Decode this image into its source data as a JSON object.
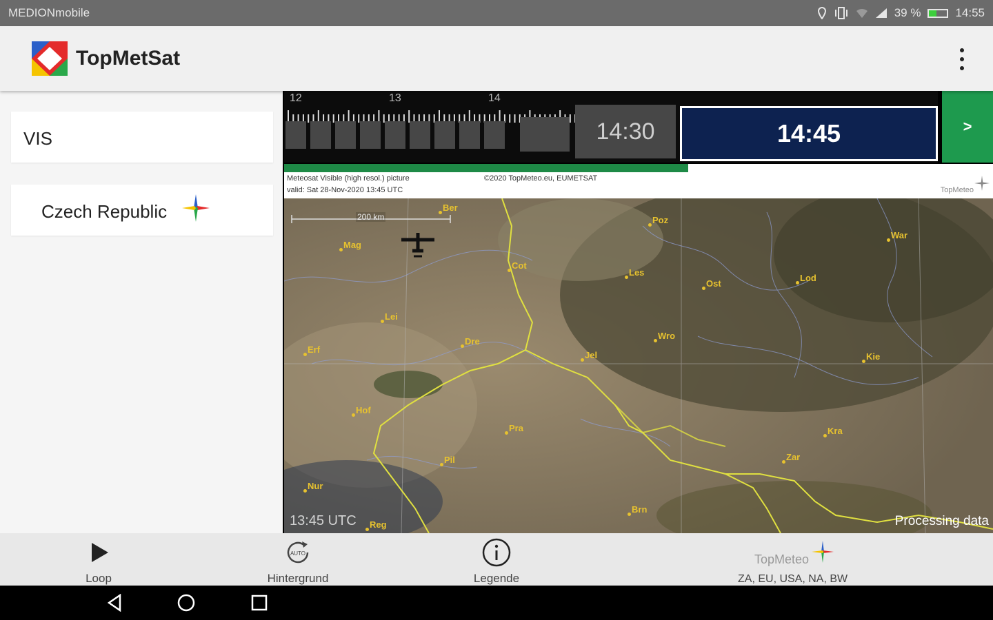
{
  "status_bar": {
    "carrier": "MEDIONmobile",
    "battery": "39 %",
    "battery_level": 0.39,
    "time": "14:55"
  },
  "app_bar": {
    "title": "TopMetSat",
    "menu_icon": "more-vert-icon"
  },
  "sidebar": {
    "product": "VIS",
    "region": "Czech Republic",
    "region_icon": "compass-star-icon"
  },
  "timeline": {
    "hours": [
      "12",
      "13",
      "14"
    ],
    "previous_frame": "14:30",
    "current_frame": "14:45",
    "next_label": ">",
    "load_progress": 0.57
  },
  "map_info": {
    "product_line": "Meteosat Visible (high resol.) picture",
    "valid_line": "valid:  Sat 28-Nov-2020  13:45 UTC",
    "copyright": "©2020 TopMeteo.eu, EUMETSAT",
    "brand": "TopMeteo"
  },
  "map": {
    "scale": "200 km",
    "cities": [
      "Ber",
      "Poz",
      "Mag",
      "War",
      "Cot",
      "Les",
      "Ost",
      "Lod",
      "Lei",
      "Dre",
      "Wro",
      "Kie",
      "Erf",
      "Jel",
      "Hof",
      "Pra",
      "Kra",
      "Zar",
      "Pil",
      "Nur",
      "Brn",
      "Reg"
    ],
    "timestamp": "13:45 UTC",
    "status": "Processing data"
  },
  "bottom_nav": {
    "loop": "Loop",
    "background": "Hintergrund",
    "background_badge": "AUTO",
    "legend": "Legende",
    "brand": "TopMeteo",
    "regions": "ZA, EU, USA, NA, BW"
  },
  "colors": {
    "accent_green": "#1e9a4e",
    "current_frame": "#0d2250",
    "city_label": "#e7c22f",
    "border": "#e0e040"
  }
}
